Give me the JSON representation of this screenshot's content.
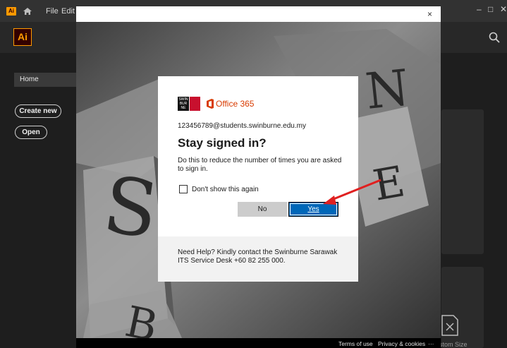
{
  "titlebar": {
    "app_icon": "Ai",
    "menu": [
      "File",
      "Edit"
    ],
    "minimize": "–",
    "maximize": "□",
    "close": "✕"
  },
  "header": {
    "logo": "Ai"
  },
  "sidebar": {
    "home": "Home",
    "create_new": "Create new",
    "open": "Open"
  },
  "browser": {
    "close": "×"
  },
  "dialog": {
    "org_logo": "SWIN BUR NE",
    "product": "Office 365",
    "email": "123456789@students.swinburne.edu.my",
    "title": "Stay signed in?",
    "description": "Do this to reduce the number of times you are asked to sign in.",
    "checkbox_label": "Don't show this again",
    "no_label": "No",
    "yes_label": "Yes",
    "help": "Need Help? Kindly contact the Swinburne Sarawak ITS Service Desk +60 82 255 000."
  },
  "footer": {
    "terms": "Terms of use",
    "privacy": "Privacy & cookies",
    "more": "···"
  },
  "right_panel": {
    "custom_size_label": "stom Size"
  },
  "colors": {
    "ai_orange": "#ff9a00",
    "office_orange": "#d83b01",
    "swinburne_red": "#c8102e",
    "yes_blue": "#0067b8",
    "arrow_red": "#e02020"
  }
}
